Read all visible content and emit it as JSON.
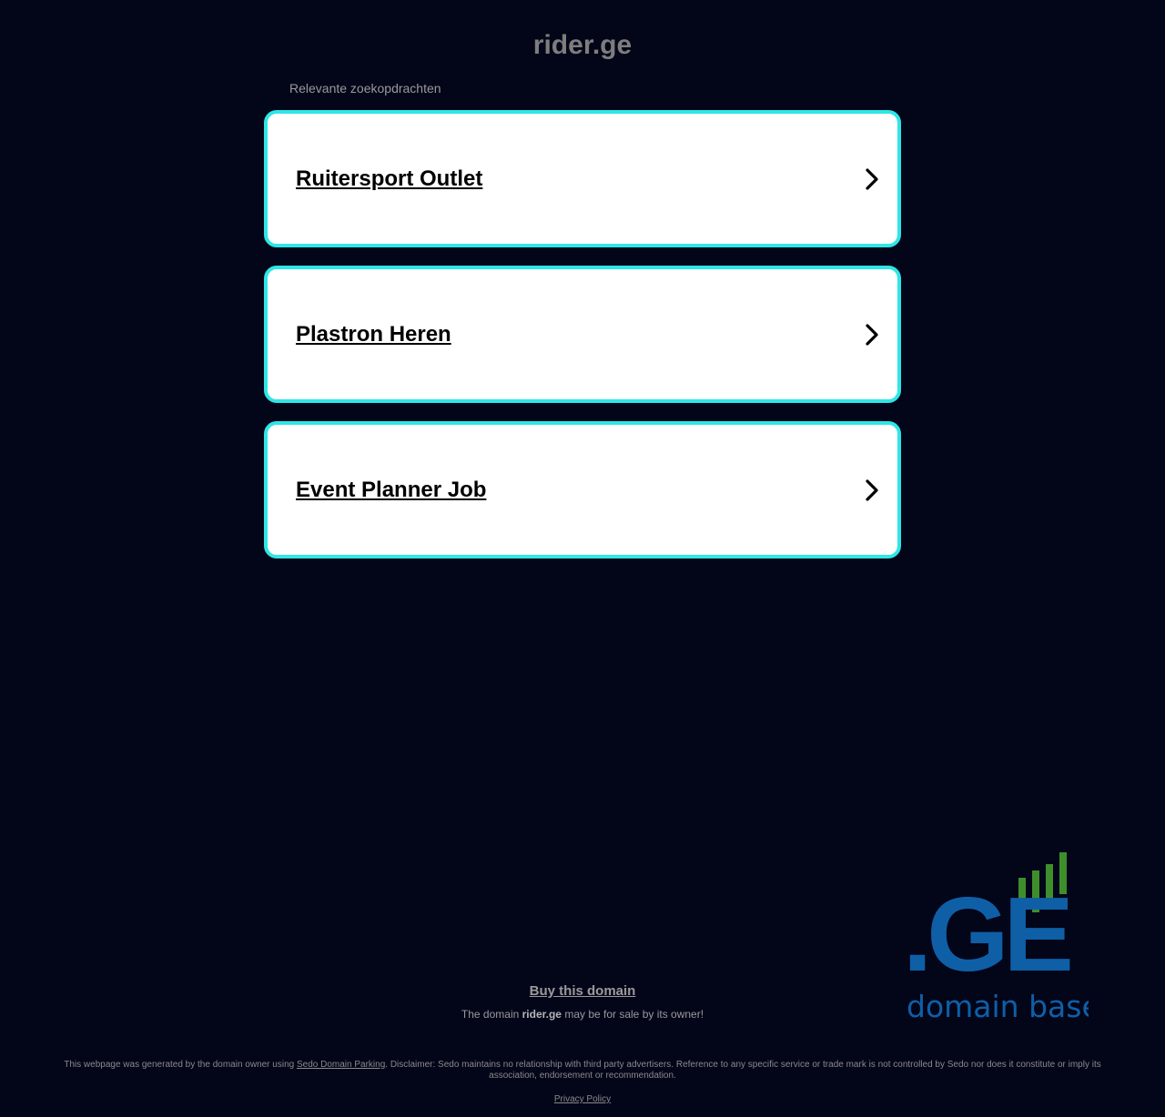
{
  "header": {
    "domain_title": "rider.ge",
    "related_label": "Relevante zoekopdrachten"
  },
  "results": [
    {
      "label": "Ruitersport Outlet"
    },
    {
      "label": "Plastron Heren"
    },
    {
      "label": "Event Planner Job"
    }
  ],
  "logo": {
    "text_ge": ".GE",
    "text_sub": "domain base",
    "colors": {
      "blue": "#0e5fa6",
      "green": "#3e8f2c"
    }
  },
  "sale": {
    "buy_label": "Buy this domain",
    "prefix": "The domain ",
    "domain": "rider.ge",
    "suffix": " may be for sale by its owner!"
  },
  "footer": {
    "part1": "This webpage was generated by the domain owner using ",
    "sedo_link": "Sedo Domain Parking",
    "part2": ". Disclaimer: Sedo maintains no relationship with third party advertisers. Reference to any specific service or trade mark is not controlled by Sedo nor does it constitute or imply its association, endorsement or recommendation.",
    "privacy_label": "Privacy Policy"
  },
  "colors": {
    "background": "#030519",
    "card_border": "#2ee6e6"
  }
}
